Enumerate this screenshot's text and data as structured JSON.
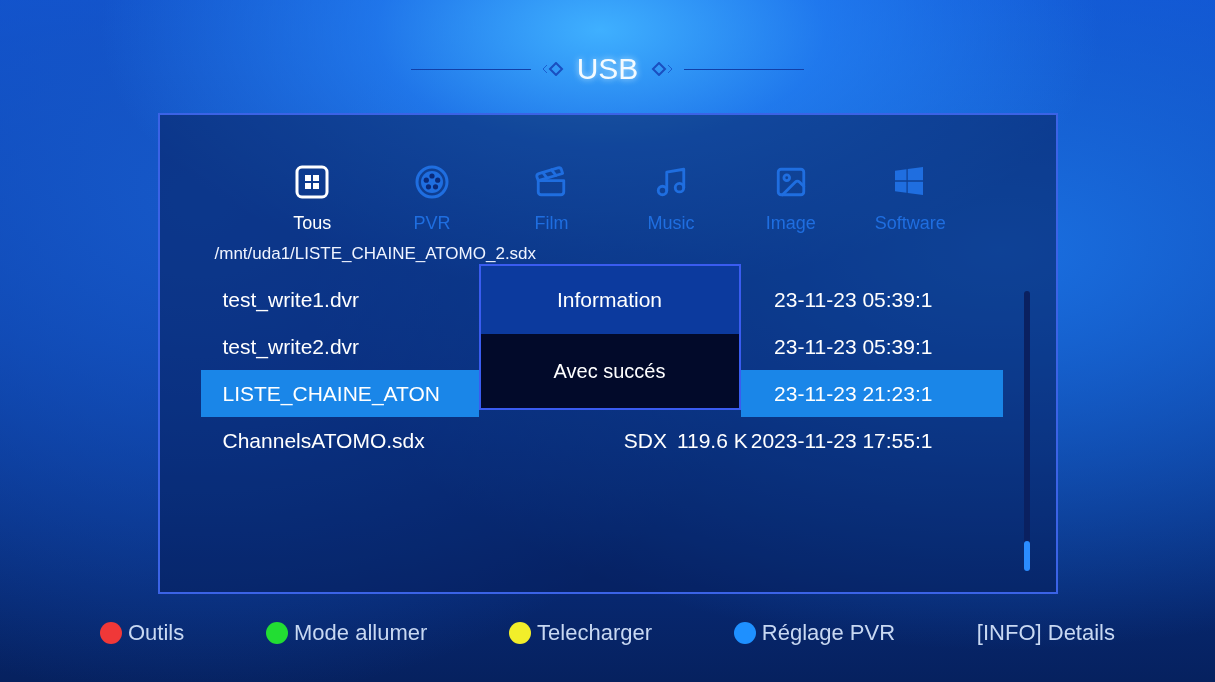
{
  "title": "USB",
  "categories": [
    {
      "label": "Tous",
      "kind": "all",
      "selected": true
    },
    {
      "label": "PVR",
      "kind": "pvr",
      "selected": false
    },
    {
      "label": "Film",
      "kind": "film",
      "selected": false
    },
    {
      "label": "Music",
      "kind": "music",
      "selected": false
    },
    {
      "label": "Image",
      "kind": "image",
      "selected": false
    },
    {
      "label": "Software",
      "kind": "software",
      "selected": false
    }
  ],
  "path": "/mnt/uda1/LISTE_CHAINE_ATOMO_2.sdx",
  "files": [
    {
      "name": "test_write1.dvr",
      "date": "23-11-23 05:39:1",
      "selected": false
    },
    {
      "name": "test_write2.dvr",
      "date": "23-11-23 05:39:1",
      "selected": false
    },
    {
      "name": "LISTE_CHAINE_ATON",
      "date": "23-11-23 21:23:1",
      "selected": true
    },
    {
      "name": "ChannelsATOMO.sdx",
      "type": "SDX",
      "size": "119.6 K",
      "date": "2023-11-23 17:55:1",
      "selected": false
    }
  ],
  "dialog": {
    "title": "Information",
    "message": "Avec succés"
  },
  "footer": [
    {
      "label": "Outils",
      "color": "#f03838"
    },
    {
      "label": "Mode allumer",
      "color": "#22dd33"
    },
    {
      "label": "Telecharger",
      "color": "#f2ee2a"
    },
    {
      "label": "Réglage PVR",
      "color": "#1e90ff"
    },
    {
      "label": "[INFO] Details"
    }
  ]
}
